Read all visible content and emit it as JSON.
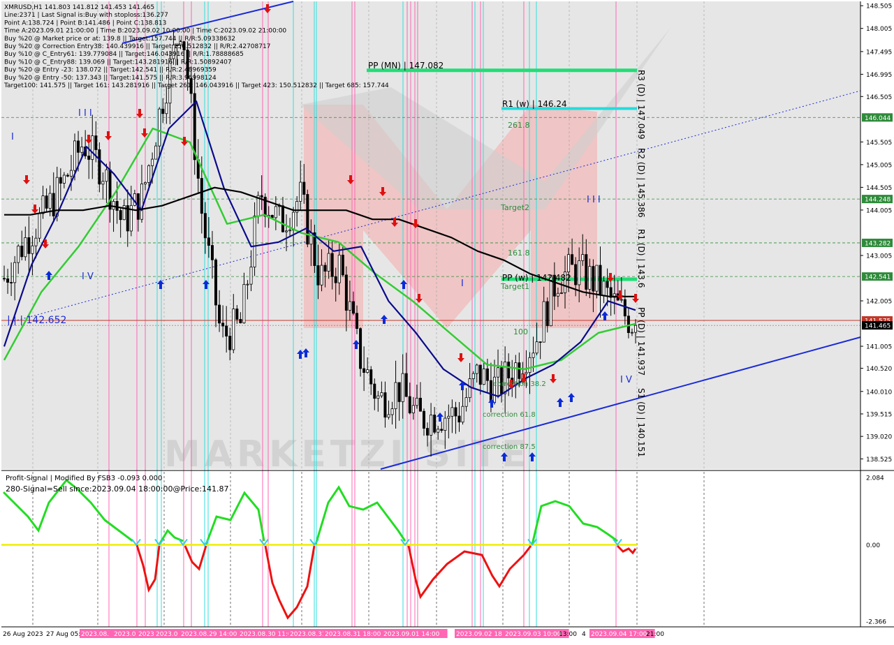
{
  "colors": {
    "background": "#ffffff",
    "chart_bg": "#e6e6e6",
    "candle": "#000000",
    "sma_black": "#000000",
    "sma_blue": "#0a0a8c",
    "sma_green": "#33cc33",
    "channel_blue": "#1b2bd6",
    "pivot_green": "#22dd77",
    "pivot_cyan": "#22dddd",
    "vline_pink": "#ff66b3",
    "vline_cyan": "#33dddd",
    "signal_up": "#22dd22",
    "signal_down": "#ee1111",
    "zero_line": "#eeee00",
    "arrow_up": "#0b2bd9",
    "arrow_down": "#e01010",
    "current_price_bg": "#000000",
    "watermark": "#f2b9b9"
  },
  "info_panel": {
    "lines": [
      "XMRUSD,H1  141.803 141.812 141.453 141.465",
      "Line:2371 | Last Signal is:Buy with stoploss:136.277",
      "Point A:138.724 | Point B:141.486 | Point C:138.813",
      "Time A:2023.09.01 21:00:00 | Time B:2023.09.02 10:00:00 | Time C:2023.09.02 21:00:00",
      "Buy %20 @ Market price or at: 139.8 || Target:157.744 || R/R:5.09338632",
      "Buy %20 @ Correction Entry38: 140.439916 || Target:150.512832 || R/R:2.42708717",
      "Buy %10 @ C_Entry61: 139.779084 || Target:146.043916 || R/R:1.78888685",
      "Buy %10 @ C_Entry88: 139.069 || Target:143.281916 || R/R:1.50892407",
      "Buy %20 @ Entry -23: 138.072 || Target:142.541 || R/R:2.48969359",
      "Buy %20 @ Entry -50: 137.343 || Target:141.575 || R/R:3.96998124",
      "Target100: 141.575 || Target 161: 143.281916 || Target 261: 146.043916 || Target 423: 150.512832 || Target 685: 157.744"
    ]
  },
  "indicator_panel": {
    "line1": "Profit-Signal | Modified By FSB3 -0.093 0.000",
    "line2": "280-Signal=Sell since:2023.09.04 18:00:00@Price:141.87"
  },
  "price_axis": {
    "ticks": [
      "148.505",
      "148.005",
      "147.495",
      "146.995",
      "146.505",
      "146.044",
      "145.505",
      "145.005",
      "144.505",
      "144.248",
      "144.005",
      "143.282",
      "143.005",
      "142.541",
      "142.005",
      "141.575",
      "141.465",
      "141.005",
      "140.520",
      "140.010",
      "139.515",
      "139.020",
      "138.525"
    ],
    "tick_values": [
      148.505,
      148.005,
      147.495,
      146.995,
      146.505,
      146.044,
      145.505,
      145.005,
      144.505,
      144.248,
      144.005,
      143.282,
      143.005,
      142.541,
      142.005,
      141.575,
      141.465,
      141.005,
      140.52,
      140.01,
      139.515,
      139.02,
      138.525
    ],
    "highlighted": [
      {
        "label": "146.044",
        "color": "#2e8b3a"
      },
      {
        "label": "144.248",
        "color": "#2e8b3a"
      },
      {
        "label": "143.282",
        "color": "#2e8b3a"
      },
      {
        "label": "142.541",
        "color": "#2e8b3a"
      },
      {
        "label": "141.575",
        "color": "#c0392b"
      },
      {
        "label": "141.465",
        "color": "#000000"
      }
    ]
  },
  "indicator_axis": {
    "ticks": [
      "2.084",
      "0.00",
      "-2.366"
    ],
    "tick_values": [
      2.084,
      0.0,
      -2.366
    ]
  },
  "time_axis": {
    "labels": [
      "26 Aug 2023",
      "27 Aug 05:00",
      "2023.08.",
      "2023.0",
      "2023.08",
      "2023.0",
      "2023.08.29 14:00",
      "2023.08.30 11:0",
      "2023.08.31",
      "2023.08.31 18:00",
      "2023.09.01 14:00",
      "2023.09.02 18",
      "2023.09.03 10:00",
      "13:00",
      "4",
      "2023.09.04 17:00",
      "21:00"
    ],
    "highlighted_labels": [
      "2023.08.",
      "2023.0",
      "2023.08",
      "2023.0",
      "2023.08.29 14:00",
      "2023.08.30 11:0",
      "2023.08.31",
      "2023.08.31 18:00",
      "2023.09.01 14:00",
      "2023.09.02 18",
      "2023.09.03 10:00",
      "2023.09.04 17:00"
    ]
  },
  "annotations": {
    "pp_mn": "PP (MN) | 147.082",
    "r1_w": "R1 (w) | 146.24",
    "pp_w": "PP (w) | 142.482",
    "level_261": "261.8",
    "level_target2": "Target2",
    "level_161": "161.8",
    "level_target1": "Target1",
    "level_100": "100",
    "left_price_label": "| | | 142.652",
    "wave_I_left": "I",
    "wave_III_left": "I I I",
    "wave_IV_left": "I V",
    "wave_I_mid": "I",
    "wave_III_right": "I I I",
    "wave_IV_right": "I V",
    "correction_38": "correction 38.2",
    "correction_61": "correction 61.8",
    "correction_87": "correction 87.5",
    "daily_r3": "R3 (D) | 147.049",
    "daily_r2": "R2 (D) | 145.386",
    "daily_r1": "R1 (D) | 143.6",
    "daily_pp": "PP (D) | 141.937",
    "daily_s1": "S1 (D) | 140.151",
    "watermark": "MARKETZI SITE"
  },
  "chart_data": {
    "type": "candlestick",
    "title": "XMRUSD,H1",
    "ylim": [
      138.3,
      148.6
    ],
    "x": [
      "26 Aug 2023",
      "27 Aug 05:00",
      "2023.08.29 14:00",
      "2023.08.30 11:00",
      "2023.08.31 18:00",
      "2023.09.01 14:00",
      "2023.09.02 18:00",
      "2023.09.03 10:00",
      "13:00",
      "2023.09.04 17:00",
      "21:00"
    ],
    "current_price": 141.465,
    "levels": [
      {
        "name": "PP (MN)",
        "value": 147.082
      },
      {
        "name": "R1 (w)",
        "value": 146.24
      },
      {
        "name": "261.8",
        "value": 146.044
      },
      {
        "name": "Target2",
        "value": 144.248
      },
      {
        "name": "161.8",
        "value": 143.282
      },
      {
        "name": "PP (w)",
        "value": 142.482
      },
      {
        "name": "Target1",
        "value": 142.541
      },
      {
        "name": "100",
        "value": 141.575
      },
      {
        "name": "| | | ",
        "value": 142.652
      }
    ],
    "price_path": [
      142.5,
      143.3,
      143.9,
      144.6,
      145.5,
      144.9,
      143.7,
      144.3,
      146.4,
      148.2,
      144.0,
      141.2,
      141.5,
      144.4,
      143.7,
      144.3,
      142.5,
      142.8,
      140.8,
      139.8,
      140.1,
      139.4,
      139.5,
      139.5,
      140.4,
      140.1,
      140.6,
      141.2,
      142.5,
      142.7,
      142.4,
      141.9,
      141.465
    ],
    "sma_black": [
      143.9,
      143.9,
      144.0,
      144.0,
      144.1,
      144.0,
      144.1,
      144.3,
      144.5,
      144.4,
      144.2,
      144.0,
      144.0,
      144.0,
      143.8,
      143.8,
      143.6,
      143.4,
      143.1,
      142.9,
      142.6,
      142.4,
      142.2,
      142.1,
      142.1
    ],
    "sma_blue": [
      141.0,
      142.8,
      144.0,
      145.4,
      144.8,
      144.0,
      145.8,
      146.4,
      144.5,
      143.2,
      143.3,
      143.6,
      143.1,
      143.2,
      142.0,
      141.3,
      140.5,
      140.1,
      139.9,
      140.3,
      140.6,
      141.1,
      142.0,
      141.8
    ],
    "sma_green": [
      140.7,
      142.2,
      143.2,
      144.4,
      145.8,
      145.5,
      143.7,
      143.9,
      143.5,
      143.3,
      142.6,
      142.0,
      141.3,
      140.6,
      140.5,
      140.7,
      141.3,
      141.5
    ]
  }
}
